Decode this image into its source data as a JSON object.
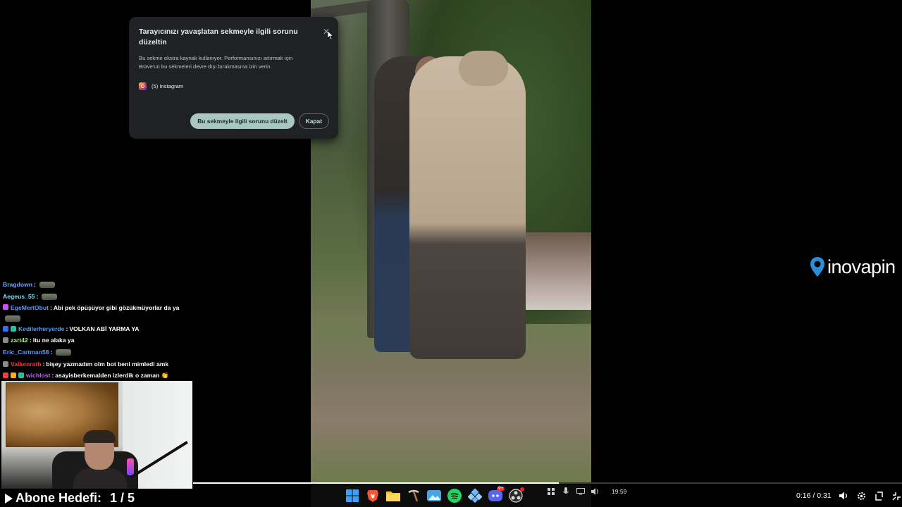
{
  "popup": {
    "title": "Tarayıcınızı yavaşlatan sekmeyle ilgili sorunu düzeltin",
    "description": "Bu sekme ekstra kaynak kullanıyor. Performansınızı artırmak için Brave'un bu sekmeleri devre dışı bırakmasına izin verin.",
    "tab_label": "(5) Instagram",
    "fix_button": "Bu sekmeyle ilgili sorunu düzelt",
    "close_button": "Kapat"
  },
  "logo": {
    "text": "inovapin",
    "color": "#2a8fd8"
  },
  "chat": [
    {
      "user": "Bragdown",
      "color": "#6aa9ff",
      "text": "",
      "emote": true
    },
    {
      "user": "Aegeus_55",
      "color": "#6ee0ff",
      "text": "",
      "emote": true
    },
    {
      "user": "EgeMertObut",
      "color": "#4e9dff",
      "text": "Abi pek öpüşüyor gibi gözükmüyorlar da ya",
      "emote": true,
      "badges": [
        "#d04cff"
      ]
    },
    {
      "user": "Kedilerheryerde",
      "color": "#4e9dff",
      "text": "VOLKAN ABİ YARMA YA",
      "badges": [
        "#2f6cff",
        "#22c3a0"
      ]
    },
    {
      "user": "zart42",
      "color": "#9ef07a",
      "text": "itu ne alaka ya",
      "badges": [
        "#8a8a8a"
      ]
    },
    {
      "user": "Eric_Cartman58",
      "color": "#4e9dff",
      "text": "",
      "emote": true
    },
    {
      "user": "Valkenrath",
      "color": "#ff3030",
      "text": "bişey yazmadım olm bot beni mimledi amk",
      "badges": [
        "#8a8a8a"
      ]
    },
    {
      "user": "wichlost",
      "color": "#c061ff",
      "text": "asayisberkemalden izlerdik o zaman 👏",
      "badges": [
        "#ff3b3b",
        "#ffb000",
        "#22c3a0"
      ]
    }
  ],
  "goal": {
    "label": "Abone Hedefi:",
    "value": "1 / 5"
  },
  "taskbar": {
    "icons": [
      "windows-start-icon",
      "brave-icon",
      "file-explorer-icon",
      "pickaxe-icon",
      "photos-icon",
      "spotify-icon",
      "network-icon",
      "discord-icon",
      "obs-icon"
    ],
    "discord_badge": "9+",
    "time": "19:59"
  },
  "player": {
    "time": "0:16 / 0:31",
    "progress": 0.516
  },
  "colors": {
    "accent": "#a8c7c0",
    "popup_bg": "#202124"
  }
}
